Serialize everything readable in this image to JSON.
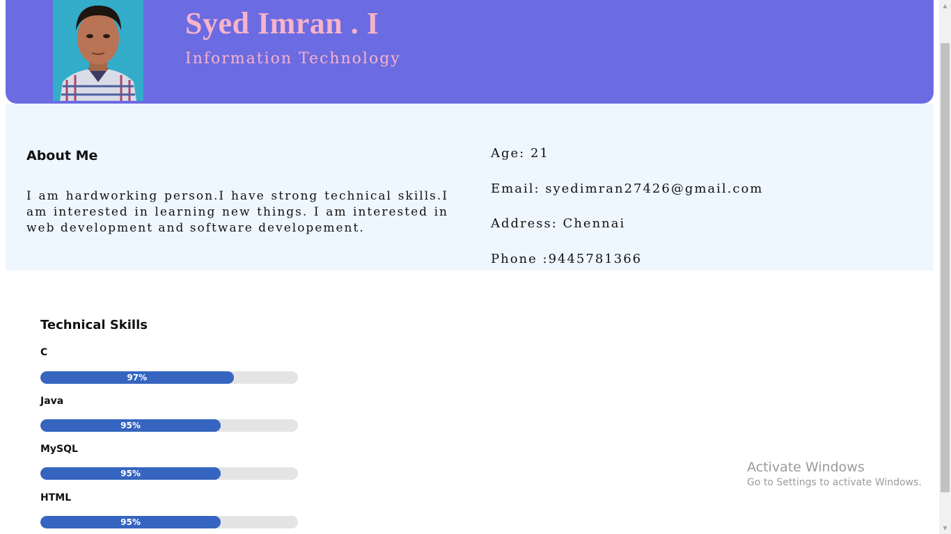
{
  "header": {
    "name": "Syed Imran . I",
    "department": "Information Technology",
    "colors": {
      "background": "#6b6be2",
      "text": "#f7b3c8"
    }
  },
  "about": {
    "title": "About Me",
    "text": "I am hardworking person.I have strong technical skills.I am interested in learning new things. I am interested in web development and software developement."
  },
  "contact": {
    "age": "Age: 21",
    "email": "Email: syedimran27426@gmail.com",
    "address": "Address: Chennai",
    "phone": "Phone :9445781366"
  },
  "skills": {
    "title": "Technical Skills",
    "bar_color": "#3565c0",
    "items": [
      {
        "name": "C",
        "label": "97%",
        "fill": 0.75
      },
      {
        "name": "Java",
        "label": "95%",
        "fill": 0.7
      },
      {
        "name": "MySQL",
        "label": "95%",
        "fill": 0.7
      },
      {
        "name": "HTML",
        "label": "95%",
        "fill": 0.7
      }
    ]
  },
  "watermark": {
    "title": "Activate Windows",
    "subtitle": "Go to Settings to activate Windows."
  },
  "scrollbar": {
    "up_icon": "triangle-up-icon",
    "down_icon": "triangle-down-icon"
  }
}
